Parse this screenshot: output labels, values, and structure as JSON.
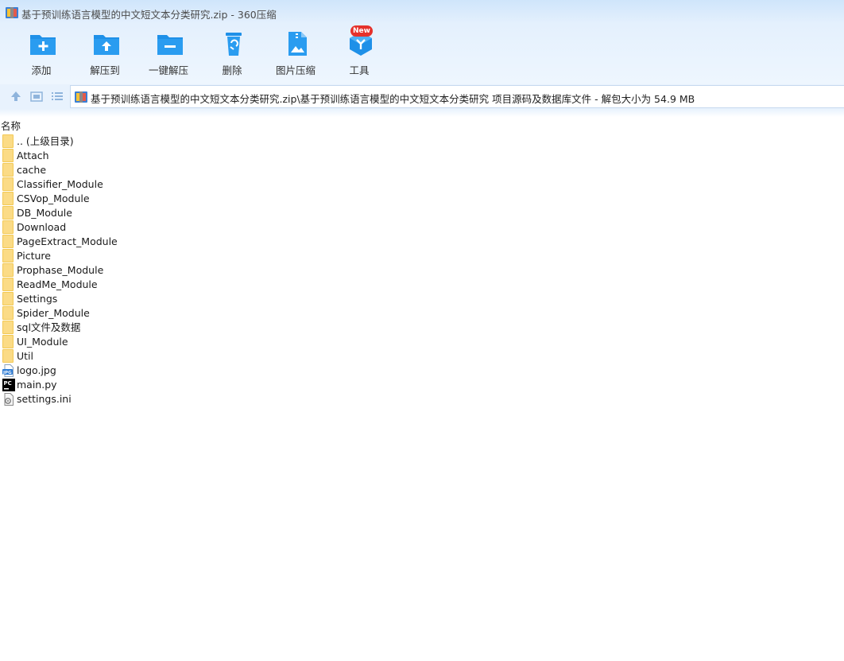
{
  "window": {
    "title": "基于预训练语言模型的中文短文本分类研究.zip - 360压缩"
  },
  "toolbar": {
    "items": [
      {
        "label": "添加",
        "icon": "add-folder-icon"
      },
      {
        "label": "解压到",
        "icon": "extract-to-folder-icon"
      },
      {
        "label": "一键解压",
        "icon": "one-click-extract-icon"
      },
      {
        "label": "删除",
        "icon": "recycle-bin-icon"
      },
      {
        "label": "图片压缩",
        "icon": "image-compress-icon"
      },
      {
        "label": "工具",
        "icon": "tools-cube-icon"
      }
    ],
    "badge": "New"
  },
  "nav": {
    "address": "基于预训练语言模型的中文短文本分类研究.zip\\基于预训练语言模型的中文短文本分类研究 项目源码及数据库文件 - 解包大小为 54.9 MB"
  },
  "list": {
    "column_name": "名称",
    "rows": [
      {
        "name": ".. (上级目录)",
        "type": "folder"
      },
      {
        "name": "Attach",
        "type": "folder"
      },
      {
        "name": "cache",
        "type": "folder"
      },
      {
        "name": "Classifier_Module",
        "type": "folder"
      },
      {
        "name": "CSVop_Module",
        "type": "folder"
      },
      {
        "name": "DB_Module",
        "type": "folder"
      },
      {
        "name": "Download",
        "type": "folder"
      },
      {
        "name": "PageExtract_Module",
        "type": "folder"
      },
      {
        "name": "Picture",
        "type": "folder"
      },
      {
        "name": "Prophase_Module",
        "type": "folder"
      },
      {
        "name": "ReadMe_Module",
        "type": "folder"
      },
      {
        "name": "Settings",
        "type": "folder"
      },
      {
        "name": "Spider_Module",
        "type": "folder"
      },
      {
        "name": "sql文件及数据",
        "type": "folder"
      },
      {
        "name": "UI_Module",
        "type": "folder"
      },
      {
        "name": "Util",
        "type": "folder"
      },
      {
        "name": "logo.jpg",
        "type": "jpg"
      },
      {
        "name": "main.py",
        "type": "py"
      },
      {
        "name": "settings.ini",
        "type": "ini"
      }
    ]
  },
  "colors": {
    "accent": "#1e90e8",
    "folder": "#fbdb86",
    "badge": "#e5312b"
  }
}
